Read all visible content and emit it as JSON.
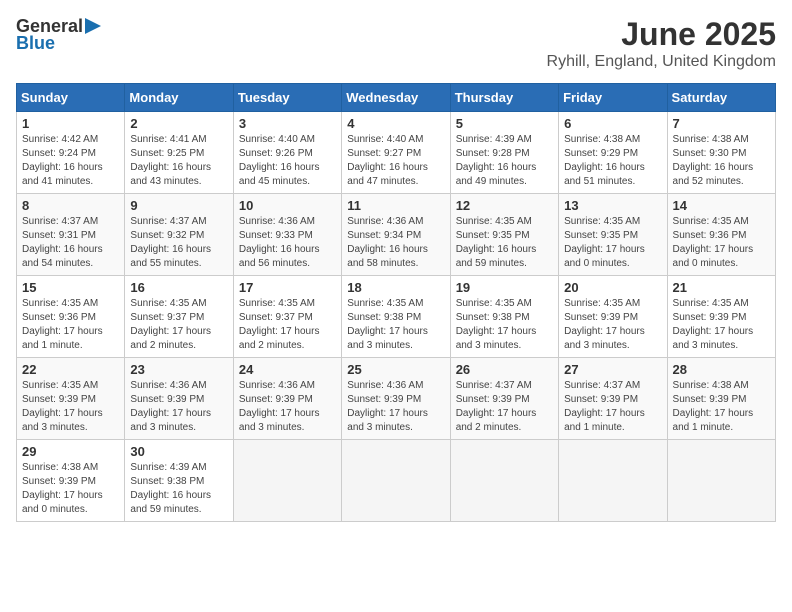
{
  "header": {
    "logo_general": "General",
    "logo_blue": "Blue",
    "month": "June 2025",
    "location": "Ryhill, England, United Kingdom"
  },
  "days_of_week": [
    "Sunday",
    "Monday",
    "Tuesday",
    "Wednesday",
    "Thursday",
    "Friday",
    "Saturday"
  ],
  "weeks": [
    [
      {
        "day": "1",
        "sunrise": "4:42 AM",
        "sunset": "9:24 PM",
        "daylight": "16 hours and 41 minutes."
      },
      {
        "day": "2",
        "sunrise": "4:41 AM",
        "sunset": "9:25 PM",
        "daylight": "16 hours and 43 minutes."
      },
      {
        "day": "3",
        "sunrise": "4:40 AM",
        "sunset": "9:26 PM",
        "daylight": "16 hours and 45 minutes."
      },
      {
        "day": "4",
        "sunrise": "4:40 AM",
        "sunset": "9:27 PM",
        "daylight": "16 hours and 47 minutes."
      },
      {
        "day": "5",
        "sunrise": "4:39 AM",
        "sunset": "9:28 PM",
        "daylight": "16 hours and 49 minutes."
      },
      {
        "day": "6",
        "sunrise": "4:38 AM",
        "sunset": "9:29 PM",
        "daylight": "16 hours and 51 minutes."
      },
      {
        "day": "7",
        "sunrise": "4:38 AM",
        "sunset": "9:30 PM",
        "daylight": "16 hours and 52 minutes."
      }
    ],
    [
      {
        "day": "8",
        "sunrise": "4:37 AM",
        "sunset": "9:31 PM",
        "daylight": "16 hours and 54 minutes."
      },
      {
        "day": "9",
        "sunrise": "4:37 AM",
        "sunset": "9:32 PM",
        "daylight": "16 hours and 55 minutes."
      },
      {
        "day": "10",
        "sunrise": "4:36 AM",
        "sunset": "9:33 PM",
        "daylight": "16 hours and 56 minutes."
      },
      {
        "day": "11",
        "sunrise": "4:36 AM",
        "sunset": "9:34 PM",
        "daylight": "16 hours and 58 minutes."
      },
      {
        "day": "12",
        "sunrise": "4:35 AM",
        "sunset": "9:35 PM",
        "daylight": "16 hours and 59 minutes."
      },
      {
        "day": "13",
        "sunrise": "4:35 AM",
        "sunset": "9:35 PM",
        "daylight": "17 hours and 0 minutes."
      },
      {
        "day": "14",
        "sunrise": "4:35 AM",
        "sunset": "9:36 PM",
        "daylight": "17 hours and 0 minutes."
      }
    ],
    [
      {
        "day": "15",
        "sunrise": "4:35 AM",
        "sunset": "9:36 PM",
        "daylight": "17 hours and 1 minute."
      },
      {
        "day": "16",
        "sunrise": "4:35 AM",
        "sunset": "9:37 PM",
        "daylight": "17 hours and 2 minutes."
      },
      {
        "day": "17",
        "sunrise": "4:35 AM",
        "sunset": "9:37 PM",
        "daylight": "17 hours and 2 minutes."
      },
      {
        "day": "18",
        "sunrise": "4:35 AM",
        "sunset": "9:38 PM",
        "daylight": "17 hours and 3 minutes."
      },
      {
        "day": "19",
        "sunrise": "4:35 AM",
        "sunset": "9:38 PM",
        "daylight": "17 hours and 3 minutes."
      },
      {
        "day": "20",
        "sunrise": "4:35 AM",
        "sunset": "9:39 PM",
        "daylight": "17 hours and 3 minutes."
      },
      {
        "day": "21",
        "sunrise": "4:35 AM",
        "sunset": "9:39 PM",
        "daylight": "17 hours and 3 minutes."
      }
    ],
    [
      {
        "day": "22",
        "sunrise": "4:35 AM",
        "sunset": "9:39 PM",
        "daylight": "17 hours and 3 minutes."
      },
      {
        "day": "23",
        "sunrise": "4:36 AM",
        "sunset": "9:39 PM",
        "daylight": "17 hours and 3 minutes."
      },
      {
        "day": "24",
        "sunrise": "4:36 AM",
        "sunset": "9:39 PM",
        "daylight": "17 hours and 3 minutes."
      },
      {
        "day": "25",
        "sunrise": "4:36 AM",
        "sunset": "9:39 PM",
        "daylight": "17 hours and 3 minutes."
      },
      {
        "day": "26",
        "sunrise": "4:37 AM",
        "sunset": "9:39 PM",
        "daylight": "17 hours and 2 minutes."
      },
      {
        "day": "27",
        "sunrise": "4:37 AM",
        "sunset": "9:39 PM",
        "daylight": "17 hours and 1 minute."
      },
      {
        "day": "28",
        "sunrise": "4:38 AM",
        "sunset": "9:39 PM",
        "daylight": "17 hours and 1 minute."
      }
    ],
    [
      {
        "day": "29",
        "sunrise": "4:38 AM",
        "sunset": "9:39 PM",
        "daylight": "17 hours and 0 minutes."
      },
      {
        "day": "30",
        "sunrise": "4:39 AM",
        "sunset": "9:38 PM",
        "daylight": "16 hours and 59 minutes."
      },
      null,
      null,
      null,
      null,
      null
    ]
  ]
}
